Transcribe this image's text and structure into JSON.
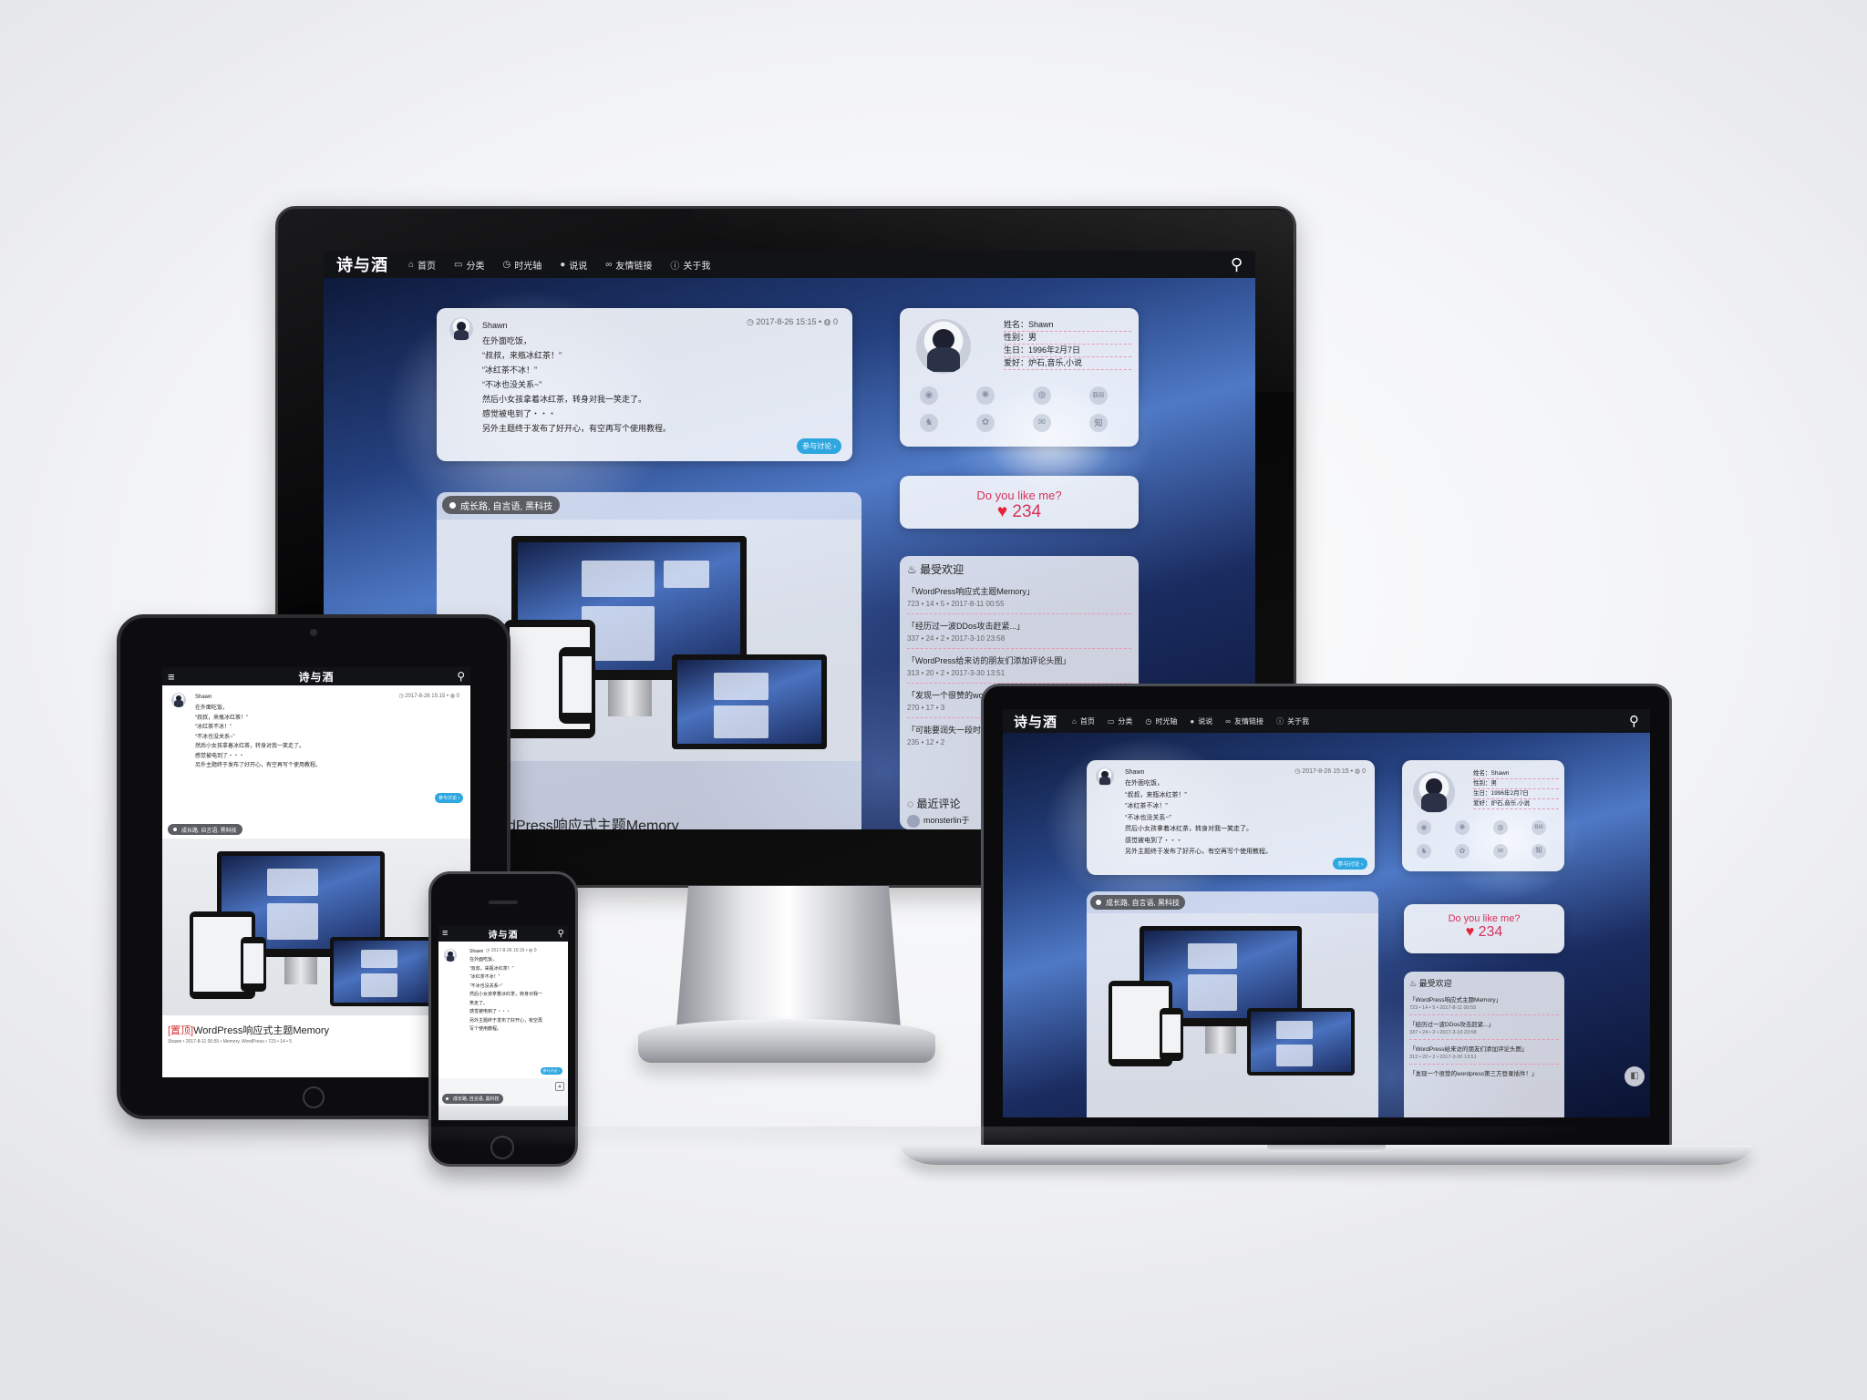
{
  "site": {
    "logo": "诗与酒",
    "nav": [
      {
        "icon": "home-icon",
        "glyph": "⌂",
        "label": "首页"
      },
      {
        "icon": "category-icon",
        "glyph": "▭",
        "label": "分类"
      },
      {
        "icon": "clock-icon",
        "glyph": "◷",
        "label": "时光轴"
      },
      {
        "icon": "comment-icon",
        "glyph": "●",
        "label": "说说"
      },
      {
        "icon": "link-icon",
        "glyph": "∞",
        "label": "友情链接"
      },
      {
        "icon": "info-icon",
        "glyph": "ⓘ",
        "label": "关于我"
      }
    ],
    "search_glyph": "⚲",
    "menu_glyph": "≡"
  },
  "post": {
    "author": "Shawn",
    "date": "2017-8-26 15:15",
    "comments": "0",
    "lines": [
      "在外面吃饭，",
      "“叔叔，来瓶冰红茶！”",
      "“冰红茶不冰！”",
      "“不冰也没关系~”",
      "然后小女孩拿着冰红茶，转身对我一笑走了。",
      "感觉被电到了・・・",
      "另外主题终于发布了好开心，有空再写个使用教程。"
    ],
    "lines_phone": [
      "在外面吃饭，",
      "“叔叔，来瓶冰红茶！”",
      "“冰红茶不冰！”",
      "“不冰也没关系~”",
      "然后小女孩拿着冰红茶，转身对我一",
      "笑走了。",
      "感觉被电到了・・・",
      "另外主题终于发布了好开心，有空再",
      "写个使用教程。"
    ],
    "discuss_button": "参与讨论 ›"
  },
  "tags_pill": "成长路, 自言语, 黑科技",
  "featured": {
    "tag": "[置顶]",
    "title": "WordPress响应式主题Memory",
    "title_partial": "dPress响应式主题Memory",
    "meta": "Shawn • 2017-8-11 00:55 • Memory, WordPress • 723 • 14 • 5"
  },
  "profile": {
    "name": "姓名：Shawn",
    "gender": "性别：男",
    "birthday": "生日：1996年2月7日",
    "hobby": "爱好：炉石,音乐,小说",
    "social_row1": [
      "rss-icon",
      "weibo-icon",
      "github-icon",
      "bilibili-icon"
    ],
    "social_row1_glyphs": [
      "◉",
      "✺",
      "◍",
      "Bili"
    ],
    "social_row2": [
      "qq-icon",
      "wechat-icon",
      "mail-icon",
      "zhihu-icon"
    ],
    "social_row2_glyphs": [
      "♞",
      "✿",
      "✉",
      "知"
    ]
  },
  "like": {
    "question": "Do you like me?",
    "count": "234"
  },
  "popular": {
    "title": "最受欢迎",
    "items": [
      {
        "title": "「WordPress响应式主题Memory」",
        "meta": "723 • 14 • 5 • 2017-8-11 00:55"
      },
      {
        "title": "「经历过一波DDos攻击赶紧...」",
        "meta": "337 • 24 • 2 • 2017-3-10 23:58"
      },
      {
        "title": "「WordPress给来访的朋友们添加评论头图」",
        "meta": "313 • 20 • 2 • 2017-3-30 13:51"
      },
      {
        "title": "「发现一个很赞的wo...",
        "meta": "270 • 17 • 3"
      },
      {
        "title": "「可能要润失一段时...",
        "meta": "235 • 12 • 2"
      }
    ],
    "laptop_last": "「发现一个很赞的wordpress第三方登录插件！」"
  },
  "recent": {
    "title": "最近评论",
    "first": "monsterlin于"
  }
}
